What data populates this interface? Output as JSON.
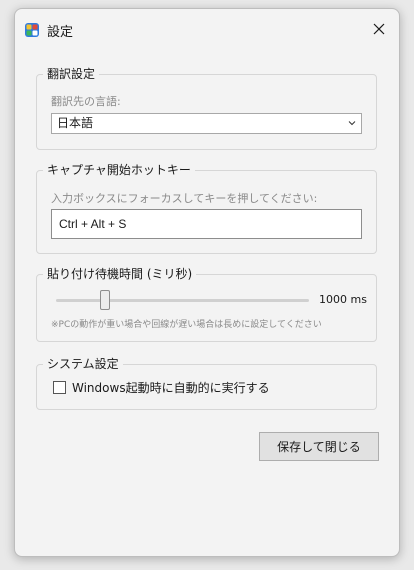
{
  "window": {
    "title": "設定",
    "app_icon": "translator-app-icon",
    "close_icon": "close-icon"
  },
  "translation": {
    "group_label": "翻訳設定",
    "target_label": "翻訳先の言語:",
    "target_value": "日本語"
  },
  "hotkey": {
    "group_label": "キャプチャ開始ホットキー",
    "instruction": "入力ボックスにフォーカスしてキーを押してください:",
    "value": "Ctrl + Alt + S"
  },
  "delay": {
    "group_label": "貼り付け待機時間 (ミリ秒)",
    "value_label": "1000 ms",
    "value": 1000,
    "slider_fraction": 0.18,
    "note": "※PCの動作が重い場合や回線が遅い場合は長めに設定してください"
  },
  "system": {
    "group_label": "システム設定",
    "startup_label": "Windows起動時に自動的に実行する",
    "startup_checked": false
  },
  "actions": {
    "save_label": "保存して閉じる"
  }
}
